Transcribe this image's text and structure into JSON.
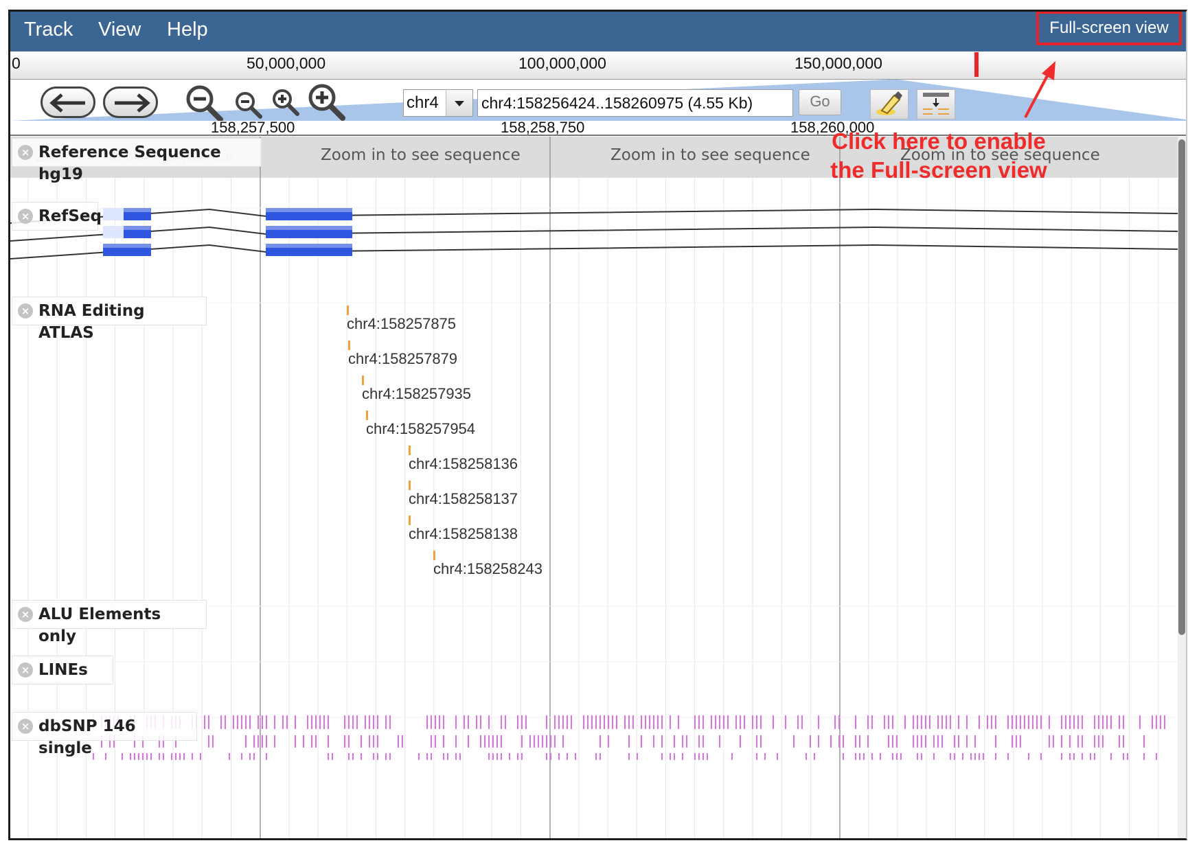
{
  "menu": {
    "track": "Track",
    "view": "View",
    "help": "Help",
    "fullscreen": "Full-screen view"
  },
  "overview": {
    "ticks": [
      "0",
      "50,000,000",
      "100,000,000",
      "150,000,000"
    ]
  },
  "nav": {
    "chromosome": "chr4",
    "location": "chr4:158256424..158260975 (4.55 Kb)",
    "go_label": "Go",
    "icons": {
      "back": "arrow-left-icon",
      "forward": "arrow-right-icon",
      "zoom_out_big": "zoom-out-icon",
      "zoom_out_small": "zoom-out-small-icon",
      "zoom_in_small": "zoom-in-small-icon",
      "zoom_in_big": "zoom-in-icon",
      "highlight": "highlighter-icon",
      "track_selector": "track-selector-icon"
    }
  },
  "detail_ruler": {
    "ticks": [
      "158,257,500",
      "158,258,750",
      "158,260,000"
    ]
  },
  "annotation": {
    "line1": "Click here to enable",
    "line2": "the Full-screen view",
    "color": "#ef2b2b"
  },
  "tracks": {
    "reference": {
      "label": "Reference Sequence hg19",
      "message": "Zoom in to see sequence"
    },
    "refseq": {
      "label": "RefSeq"
    },
    "rna_editing": {
      "label": "RNA Editing ATLAS",
      "sites": [
        "chr4:158257875",
        "chr4:158257879",
        "chr4:158257935",
        "chr4:158257954",
        "chr4:158258136",
        "chr4:158258137",
        "chr4:158258138",
        "chr4:158258243"
      ]
    },
    "alu": {
      "label": "ALU Elements only"
    },
    "lines": {
      "label": "LINEs"
    },
    "dbsnp": {
      "label": "dbSNP 146 single"
    }
  },
  "colors": {
    "menubar": "#3b6593",
    "gene": "#2f56e0",
    "snp": "#e070e8",
    "highlight": "#e8232a"
  }
}
